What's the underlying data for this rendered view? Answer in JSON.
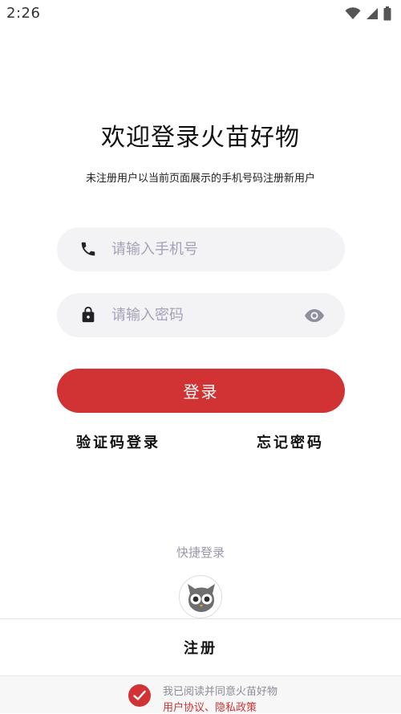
{
  "status_bar": {
    "time": "2:26",
    "icons": [
      "wifi-icon",
      "signal-icon",
      "battery-icon"
    ]
  },
  "header": {
    "title": "欢迎登录火苗好物",
    "subtitle": "未注册用户以当前页面展示的手机号码注册新用户"
  },
  "form": {
    "phone": {
      "icon": "phone-icon",
      "placeholder": "请输入手机号",
      "value": ""
    },
    "password": {
      "icon": "lock-icon",
      "placeholder": "请输入密码",
      "value": "",
      "toggle_icon": "eye-icon"
    },
    "login_label": "登录"
  },
  "links": {
    "code_login": "验证码登录",
    "forgot_password": "忘记密码"
  },
  "quick_login": {
    "label": "快捷登录",
    "icon": "owl-logo-icon"
  },
  "register_label": "注册",
  "agreement": {
    "checked": true,
    "text": "我已阅读并同意火苗好物",
    "user_agreement": "用户协议",
    "separator": "、",
    "privacy_policy": "隐私政策"
  },
  "colors": {
    "accent": "#d13335",
    "input_background": "#f3f3f6",
    "placeholder": "#a3a2b6"
  }
}
